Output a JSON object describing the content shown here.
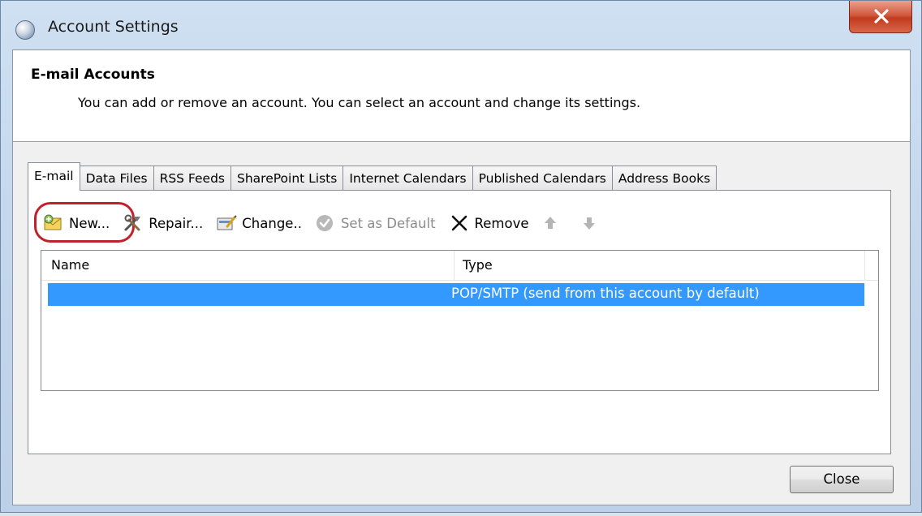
{
  "window": {
    "title": "Account Settings"
  },
  "header": {
    "title": "E-mail Accounts",
    "description": "You can add or remove an account. You can select an account and change its settings."
  },
  "tabs": [
    {
      "label": "E-mail",
      "active": true
    },
    {
      "label": "Data Files",
      "active": false
    },
    {
      "label": "RSS Feeds",
      "active": false
    },
    {
      "label": "SharePoint Lists",
      "active": false
    },
    {
      "label": "Internet Calendars",
      "active": false
    },
    {
      "label": "Published Calendars",
      "active": false
    },
    {
      "label": "Address Books",
      "active": false
    }
  ],
  "toolbar": {
    "new_label": "New...",
    "repair_label": "Repair...",
    "change_label": "Change..",
    "set_default_label": "Set as Default",
    "remove_label": "Remove",
    "icons": [
      "new-account-icon",
      "repair-icon",
      "change-icon",
      "checkmark-icon",
      "remove-x-icon",
      "arrow-up-icon",
      "arrow-down-icon"
    ]
  },
  "list": {
    "columns": [
      "Name",
      "Type"
    ],
    "rows": [
      {
        "name": "",
        "type": "POP/SMTP (send from this account by default)",
        "selected": true
      }
    ]
  },
  "footer": {
    "close_label": "Close"
  },
  "colors": {
    "selection": "#3399ff",
    "highlight_ring": "#c0212b",
    "close_button_red": "#c23b1e"
  }
}
